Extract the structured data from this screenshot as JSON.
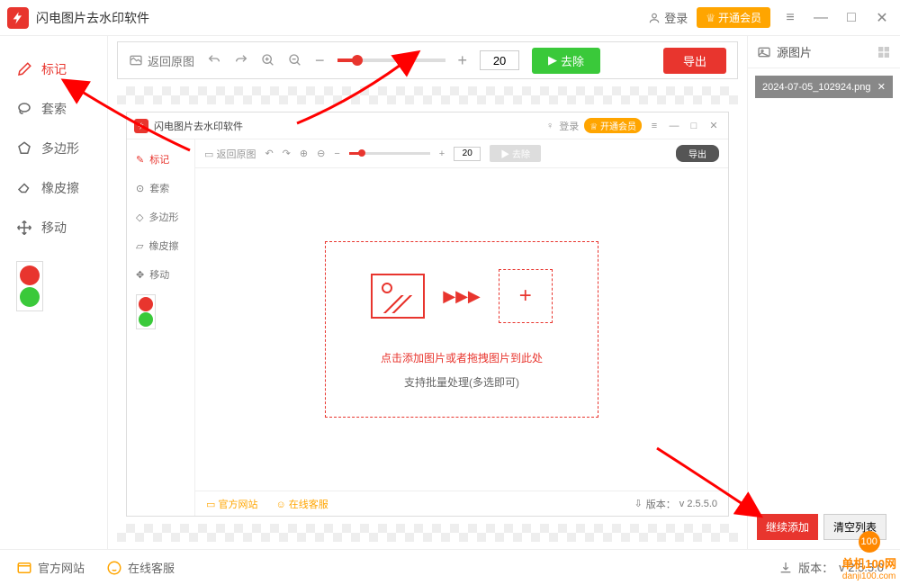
{
  "app": {
    "title": "闪电图片去水印软件"
  },
  "titlebar": {
    "login": "登录",
    "vip": "开通会员"
  },
  "tools": {
    "marker": "标记",
    "lasso": "套索",
    "polygon": "多边形",
    "eraser": "橡皮擦",
    "move": "移动"
  },
  "toolbar": {
    "back_original": "返回原图",
    "brush_size": "20",
    "remove": "去除",
    "export": "导出"
  },
  "inner": {
    "title": "闪电图片去水印软件",
    "login": "登录",
    "vip": "开通会员",
    "back": "返回原图",
    "size": "20",
    "remove": "去除",
    "export": "导出",
    "tools": {
      "marker": "标记",
      "lasso": "套索",
      "polygon": "多边形",
      "eraser": "橡皮擦",
      "move": "移动"
    },
    "drop1": "点击添加图片或者拖拽图片到此处",
    "drop2": "支持批量处理(多选即可)",
    "site": "官方网站",
    "service": "在线客服",
    "version_label": "版本：",
    "version": "v 2.5.5.0"
  },
  "right_panel": {
    "title": "源图片",
    "file": "2024-07-05_102924.png",
    "add": "继续添加",
    "clear": "清空列表"
  },
  "footer": {
    "site": "官方网站",
    "service": "在线客服",
    "version_label": "版本：",
    "version": "v 2.5.5.0"
  },
  "watermark": {
    "line1": "单机100网",
    "line2": "danji100.com"
  }
}
